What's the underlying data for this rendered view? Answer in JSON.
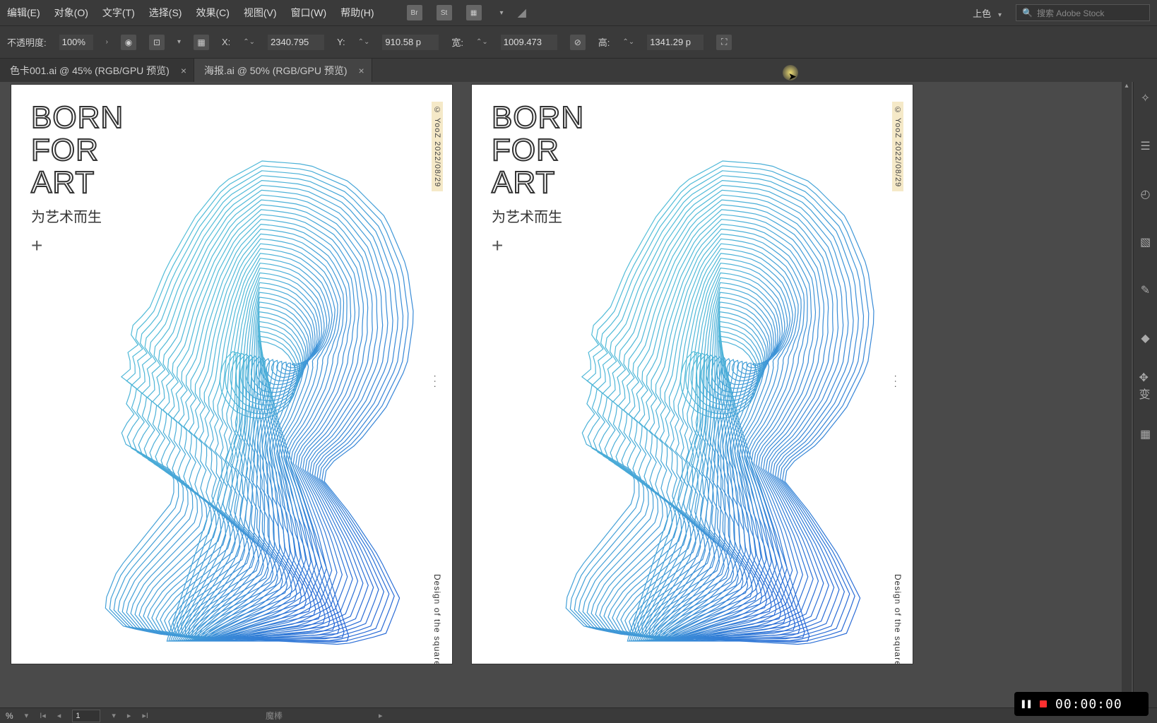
{
  "menu": [
    "编辑(E)",
    "对象(O)",
    "文字(T)",
    "选择(S)",
    "效果(C)",
    "视图(V)",
    "窗口(W)",
    "帮助(H)"
  ],
  "menu_icons": {
    "br": "Br",
    "st": "St"
  },
  "top_right": {
    "color_mode": "上色",
    "search_placeholder": "搜索 Adobe Stock"
  },
  "options": {
    "opacity_label": "不透明度:",
    "opacity_value": "100%",
    "X_label": "X:",
    "X_val": "2340.795",
    "Y_label": "Y:",
    "Y_val": "910.58 p",
    "W_label": "宽:",
    "W_val": "1009.473",
    "H_label": "高:",
    "H_val": "1341.29 p"
  },
  "tabs": [
    {
      "label": "色卡001.ai @ 45% (RGB/GPU 预览)",
      "active": false
    },
    {
      "label": "海报.ai @ 50% (RGB/GPU 预览)",
      "active": true
    }
  ],
  "art": {
    "title_lines": [
      "BORN",
      "FOR",
      "ART"
    ],
    "subtitle": "为艺术而生",
    "plus": "+",
    "vtext": "© YooZ  2022/08/29",
    "vdots": "...",
    "vcaption": "Design of the square"
  },
  "status": {
    "zoom_hint": "%",
    "page": "1",
    "tool": "魔棒"
  },
  "recorder": {
    "time": "00:00:00"
  }
}
